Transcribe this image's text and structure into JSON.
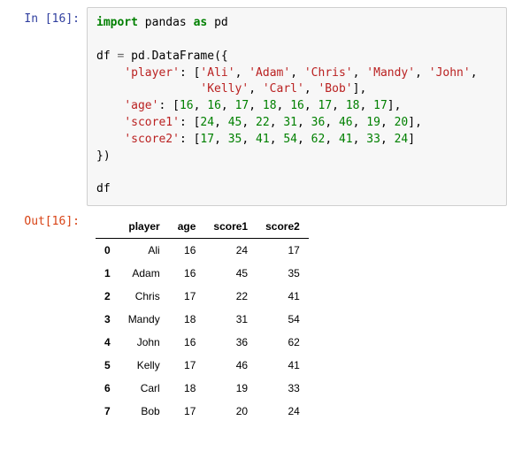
{
  "input_prompt": "In [16]:",
  "output_prompt": "Out[16]:",
  "code": {
    "l1": {
      "a": "import",
      "b": " pandas ",
      "c": "as",
      "d": " pd"
    },
    "l3": {
      "a": "df ",
      "b": "=",
      "c": " pd",
      "d": ".",
      "e": "DataFrame({"
    },
    "l4": {
      "a": "    ",
      "b": "'player'",
      "c": ": [",
      "d": "'Ali'",
      "e": ", ",
      "f": "'Adam'",
      "g": ", ",
      "h": "'Chris'",
      "i": ", ",
      "j": "'Mandy'",
      "k": ", ",
      "l": "'John'",
      "m": ","
    },
    "l5": {
      "a": "               ",
      "b": "'Kelly'",
      "c": ", ",
      "d": "'Carl'",
      "e": ", ",
      "f": "'Bob'",
      "g": "],"
    },
    "l6": {
      "a": "    ",
      "b": "'age'",
      "c": ": [",
      "d": "16",
      "e": ", ",
      "f": "16",
      "g": ", ",
      "h": "17",
      "i": ", ",
      "j": "18",
      "k": ", ",
      "l": "16",
      "m": ", ",
      "n": "17",
      "o": ", ",
      "p": "18",
      "q": ", ",
      "r": "17",
      "s": "],"
    },
    "l7": {
      "a": "    ",
      "b": "'score1'",
      "c": ": [",
      "d": "24",
      "e": ", ",
      "f": "45",
      "g": ", ",
      "h": "22",
      "i": ", ",
      "j": "31",
      "k": ", ",
      "l": "36",
      "m": ", ",
      "n": "46",
      "o": ", ",
      "p": "19",
      "q": ", ",
      "r": "20",
      "s": "],"
    },
    "l8": {
      "a": "    ",
      "b": "'score2'",
      "c": ": [",
      "d": "17",
      "e": ", ",
      "f": "35",
      "g": ", ",
      "h": "41",
      "i": ", ",
      "j": "54",
      "k": ", ",
      "l": "62",
      "m": ", ",
      "n": "41",
      "o": ", ",
      "p": "33",
      "q": ", ",
      "r": "24",
      "s": "]"
    },
    "l9": "})",
    "l11": "df"
  },
  "chart_data": {
    "type": "table",
    "columns": [
      "player",
      "age",
      "score1",
      "score2"
    ],
    "index": [
      "0",
      "1",
      "2",
      "3",
      "4",
      "5",
      "6",
      "7"
    ],
    "rows": [
      {
        "player": "Ali",
        "age": "16",
        "score1": "24",
        "score2": "17"
      },
      {
        "player": "Adam",
        "age": "16",
        "score1": "45",
        "score2": "35"
      },
      {
        "player": "Chris",
        "age": "17",
        "score1": "22",
        "score2": "41"
      },
      {
        "player": "Mandy",
        "age": "18",
        "score1": "31",
        "score2": "54"
      },
      {
        "player": "John",
        "age": "16",
        "score1": "36",
        "score2": "62"
      },
      {
        "player": "Kelly",
        "age": "17",
        "score1": "46",
        "score2": "41"
      },
      {
        "player": "Carl",
        "age": "18",
        "score1": "19",
        "score2": "33"
      },
      {
        "player": "Bob",
        "age": "17",
        "score1": "20",
        "score2": "24"
      }
    ]
  }
}
